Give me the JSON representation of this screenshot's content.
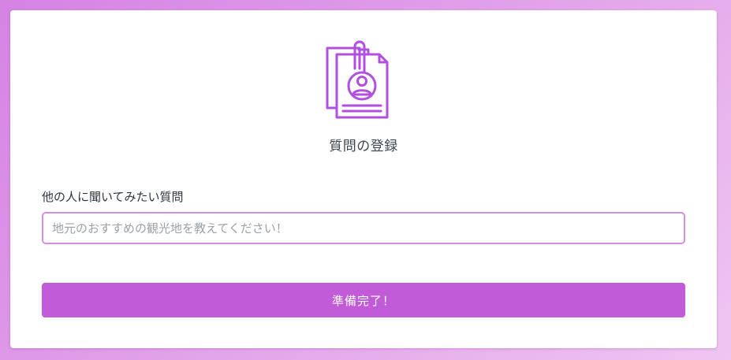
{
  "form": {
    "icon": "contact-clipboard-icon",
    "title": "質問の登録",
    "question_label": "他の人に聞いてみたい質問",
    "question_value": "",
    "question_placeholder": "地元のおすすめの観光地を教えてください！",
    "submit_label": "準備完了！"
  },
  "colors": {
    "accent": "#c15bd8",
    "input_border": "#d68ee3",
    "icon_purple": "#b04fe0",
    "background_start": "#d583e3",
    "background_end": "#efc5f2"
  }
}
